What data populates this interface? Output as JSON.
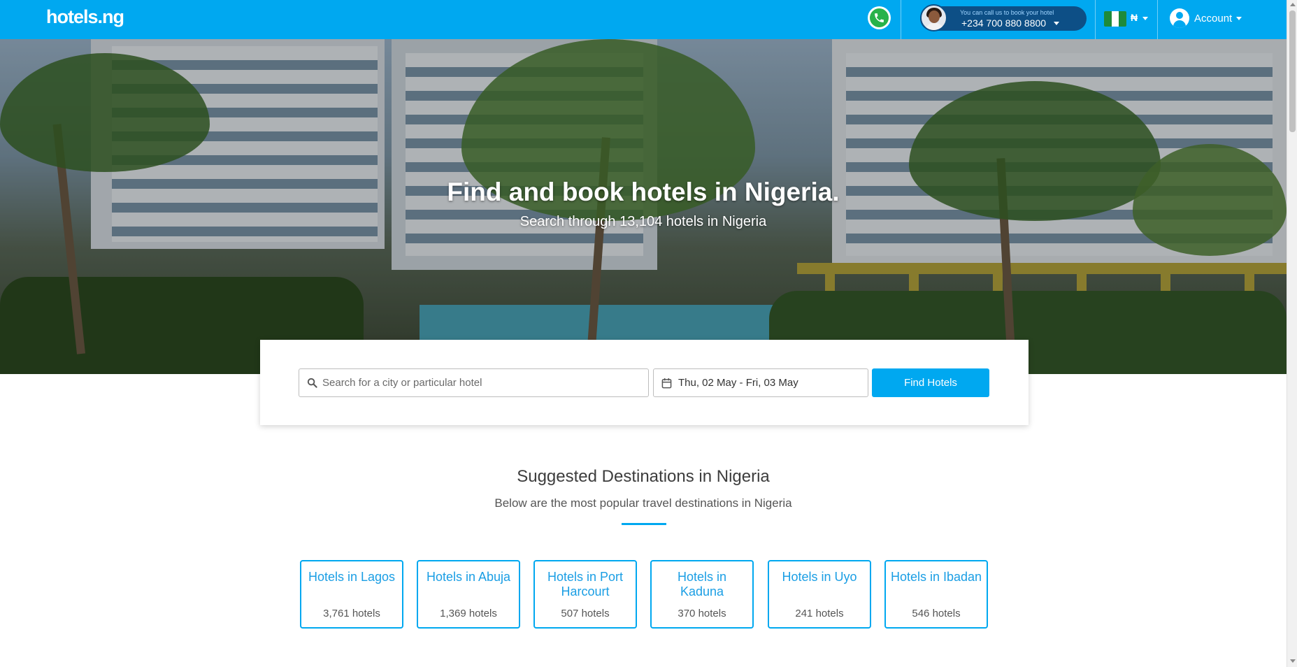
{
  "header": {
    "logo_text": "hotels.ng",
    "whatsapp_icon": "whatsapp-icon",
    "call_prompt": "You can call us to book your hotel",
    "phone_number": "+234 700 880 8800",
    "currency_symbol": "₦",
    "country_flag": "nigeria-flag-icon",
    "account_label": "Account",
    "brand_color": "#00a8f0",
    "pill_color": "#0d4f86"
  },
  "hero": {
    "title": "Find and book hotels in Nigeria.",
    "subtitle": "Search through 13,104 hotels in Nigeria"
  },
  "search": {
    "placeholder": "Search for a city or particular hotel",
    "value": "",
    "dates": "Thu, 02 May - Fri, 03 May",
    "button_label": "Find Hotels",
    "search_icon": "search-icon",
    "calendar_icon": "calendar-icon"
  },
  "suggested": {
    "title": "Suggested Destinations in Nigeria",
    "subtitle": "Below are the most popular travel destinations in Nigeria",
    "destinations": [
      {
        "name": "Hotels in Lagos",
        "count": "3,761 hotels"
      },
      {
        "name": "Hotels in Abuja",
        "count": "1,369 hotels"
      },
      {
        "name": "Hotels in Port Harcourt",
        "count": "507 hotels"
      },
      {
        "name": "Hotels in Kaduna",
        "count": "370 hotels"
      },
      {
        "name": "Hotels in Uyo",
        "count": "241 hotels"
      },
      {
        "name": "Hotels in Ibadan",
        "count": "546 hotels"
      }
    ]
  }
}
